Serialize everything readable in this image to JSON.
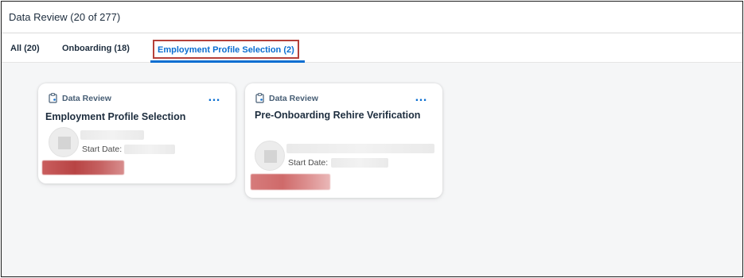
{
  "header": {
    "title": "Data Review (20 of 277)"
  },
  "tabs": [
    {
      "label": "All (20)"
    },
    {
      "label": "Onboarding (18)"
    },
    {
      "label": "Employment Profile Selection (2)",
      "selected": true
    }
  ],
  "cards": [
    {
      "kicker": "Data Review",
      "title": "Employment Profile Selection",
      "start_label": "Start Date:",
      "more_icon": "…"
    },
    {
      "kicker": "Data Review",
      "title": "Pre-Onboarding Rehire Verification",
      "start_label": "Start Date:",
      "more_icon": "…"
    }
  ],
  "colors": {
    "accent": "#0a6ed1",
    "highlight_border": "#b5413a",
    "redaction": "#b84444"
  }
}
